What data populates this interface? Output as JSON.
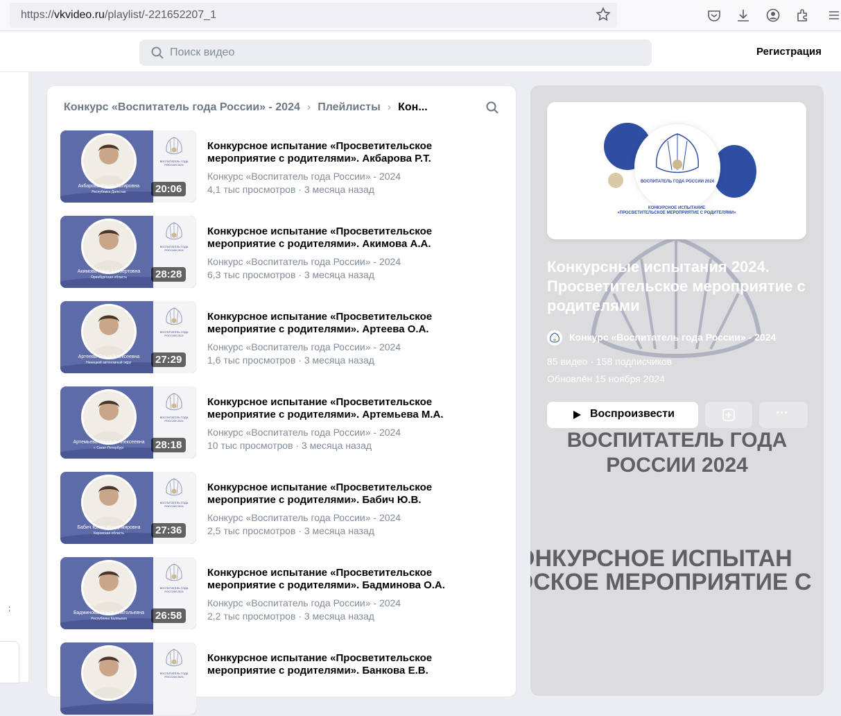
{
  "browser": {
    "url_prefix": "https://",
    "url_host": "vkvideo.ru",
    "url_path": "/playlist/-221652207_1"
  },
  "header": {
    "search_placeholder": "Поиск видео",
    "register_label": "Регистрация"
  },
  "breadcrumb": {
    "items": [
      "Конкурс «Воспитатель года России» - 2024",
      "Плейлисты",
      "Кон..."
    ]
  },
  "videos": [
    {
      "title": "Конкурсное испытание «Просветительское мероприятие с родителями». Акбарова Р.Т.",
      "channel": "Конкурс «Воспитатель года России» - 2024",
      "meta": "4,1 тыс просмотров · 3 месяца назад",
      "duration": "20:06",
      "thumb_name": "Акбарова Раила Тагировна",
      "thumb_region": "Республика Дагестан"
    },
    {
      "title": "Конкурсное испытание «Просветительское мероприятие с родителями». Акимова А.А.",
      "channel": "Конкурс «Воспитатель года России» - 2024",
      "meta": "6,3 тыс просмотров · 3 месяца назад",
      "duration": "28:28",
      "thumb_name": "Акимова Анна Альбертовна",
      "thumb_region": "Оренбургская область"
    },
    {
      "title": "Конкурсное испытание «Просветительское мероприятие с родителями». Артеева О.А.",
      "channel": "Конкурс «Воспитатель года России» - 2024",
      "meta": "1,6 тыс просмотров · 3 месяца назад",
      "duration": "27:29",
      "thumb_name": "Артеева Ольга Алексеевна",
      "thumb_region": "Ненецкий автономный округ"
    },
    {
      "title": "Конкурсное испытание «Просветительское мероприятие с родителями». Артемьева М.А.",
      "channel": "Конкурс «Воспитатель года России» - 2024",
      "meta": "10 тыс просмотров · 3 месяца назад",
      "duration": "28:18",
      "thumb_name": "Артемьева Марина Алексеевна",
      "thumb_region": "г. Санкт-Петербург"
    },
    {
      "title": "Конкурсное испытание «Просветительское мероприятие с родителями». Бабич Ю.В.",
      "channel": "Конкурс «Воспитатель года России» - 2024",
      "meta": "2,5 тыс просмотров · 3 месяца назад",
      "duration": "27:36",
      "thumb_name": "Бабич Юлия Владимировна",
      "thumb_region": "Кировская область"
    },
    {
      "title": "Конкурсное испытание «Просветительское мероприятие с родителями». Бадминова О.А.",
      "channel": "Конкурс «Воспитатель года России» - 2024",
      "meta": "2,2 тыс просмотров · 3 месяца назад",
      "duration": "26:58",
      "thumb_name": "Бадминова Ольга Анатольевна",
      "thumb_region": "Республика Калмыкия"
    },
    {
      "title": "Конкурсное испытание «Просветительское мероприятие с родителями». Банкова Е.В.",
      "channel": "",
      "meta": "",
      "duration": "",
      "thumb_name": "",
      "thumb_region": ""
    }
  ],
  "thumb_logo_text": "ВОСПИТАТЕЛЬ ГОДА РОССИИ 2024",
  "playlist": {
    "cover_logo_text": "ВОСПИТАТЕЛЬ ГОДА РОССИИ 2024",
    "cover_subtitle_1": "КОНКУРСНОЕ ИСПЫТАНИЕ",
    "cover_subtitle_2": "«ПРОСВЕТИТЕЛЬСКОЕ МЕРОПРИЯТИЕ С РОДИТЕЛЯМИ»",
    "title": "Конкурсные испытания 2024. Просветительское мероприятие с родителями",
    "channel": "Конкурс «Воспитатель года России» - 2024",
    "stats": "85 видео · 158 подписчиков",
    "updated": "Обновлён 15 ноября 2024",
    "play_label": "Воспроизвести",
    "more_label": "···",
    "bg_text_1": "ВОСПИТАТЕЛЬ ГОДА РОССИИ 2024",
    "bg_text_2": "ОНКУРСНОЕ ИСПЫТАН",
    "bg_text_3": "ЭСКОЕ МЕРОПРИЯТИЕ С"
  },
  "colors": {
    "accent_blue": "#2e4ea3",
    "thumb_blue": "#5d6ba8",
    "muted_text": "#818c99"
  }
}
